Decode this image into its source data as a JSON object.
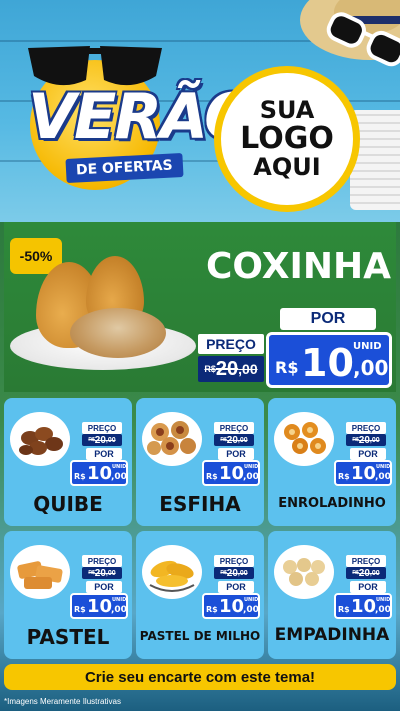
{
  "header": {
    "title": "VERÃO",
    "subtitle": "DE OFERTAS",
    "logo_placeholder": [
      "SUA",
      "LOGO",
      "AQUI"
    ]
  },
  "featured": {
    "discount_badge": "-50%",
    "name": "COXINHA",
    "preco_label": "PREÇO",
    "old_price": {
      "currency": "R$",
      "integer": "20",
      "decimal": ",00"
    },
    "por_label": "POR",
    "new_price": {
      "currency": "R$",
      "integer": "10",
      "decimal": ",00",
      "unit": "UNID"
    }
  },
  "products": [
    {
      "name": "QUIBE",
      "preco_label": "PREÇO",
      "old_price": {
        "currency": "R$",
        "integer": "20",
        "decimal": ",00"
      },
      "por_label": "POR",
      "new_price": {
        "currency": "R$",
        "integer": "10",
        "decimal": ",00",
        "unit": "UNID"
      }
    },
    {
      "name": "ESFIHA",
      "preco_label": "PREÇO",
      "old_price": {
        "currency": "R$",
        "integer": "20",
        "decimal": ",00"
      },
      "por_label": "POR",
      "new_price": {
        "currency": "R$",
        "integer": "10",
        "decimal": ",00",
        "unit": "UNID"
      }
    },
    {
      "name": "ENROLADINHO",
      "preco_label": "PREÇO",
      "old_price": {
        "currency": "R$",
        "integer": "20",
        "decimal": ",00"
      },
      "por_label": "POR",
      "new_price": {
        "currency": "R$",
        "integer": "10",
        "decimal": ",00",
        "unit": "UNID"
      }
    },
    {
      "name": "PASTEL",
      "preco_label": "PREÇO",
      "old_price": {
        "currency": "R$",
        "integer": "20",
        "decimal": ",00"
      },
      "por_label": "POR",
      "new_price": {
        "currency": "R$",
        "integer": "10",
        "decimal": ",00",
        "unit": "UNID"
      }
    },
    {
      "name": "PASTEL DE MILHO",
      "preco_label": "PREÇO",
      "old_price": {
        "currency": "R$",
        "integer": "20",
        "decimal": ",00"
      },
      "por_label": "POR",
      "new_price": {
        "currency": "R$",
        "integer": "10",
        "decimal": ",00",
        "unit": "UNID"
      }
    },
    {
      "name": "EMPADINHA",
      "preco_label": "PREÇO",
      "old_price": {
        "currency": "R$",
        "integer": "20",
        "decimal": ",00"
      },
      "por_label": "POR",
      "new_price": {
        "currency": "R$",
        "integer": "10",
        "decimal": ",00",
        "unit": "UNID"
      }
    }
  ],
  "footer": {
    "cta": "Crie seu encarte com este tema!",
    "disclaimer": "*Imagens Meramente Ilustrativas"
  },
  "colors": {
    "header_sky": "#3fa6d6",
    "featured_green": "#2e8a3a",
    "card_blue": "#5cc1ee",
    "price_blue": "#1b4fd8",
    "navy": "#0b2a78",
    "accent_yellow": "#f7c600"
  }
}
